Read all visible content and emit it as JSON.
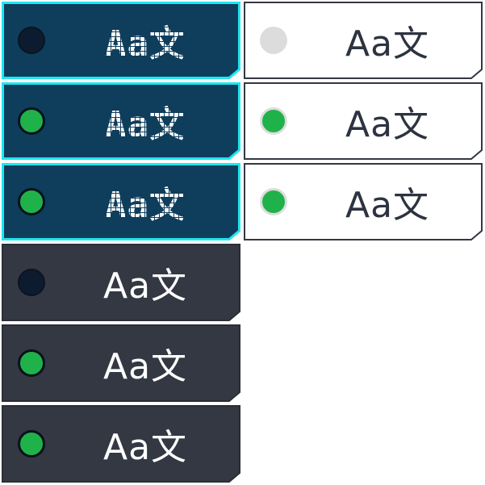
{
  "colors": {
    "retro_fill": "#0f3d5c",
    "retro_border": "#1ee6ee",
    "dark_fill": "#333842",
    "light_fill": "#ffffff",
    "light_border": "#333842",
    "indicator_on": "#1fb24a",
    "indicator_off_dark": "#0d1b2e",
    "indicator_off_light": "#dcdcdc"
  },
  "retro_column": [
    {
      "label": "Aa文",
      "indicator": "off"
    },
    {
      "label": "Aa文",
      "indicator": "on"
    },
    {
      "label": "Aa文",
      "indicator": "on"
    }
  ],
  "light_column": [
    {
      "label": "Aa文",
      "indicator": "off"
    },
    {
      "label": "Aa文",
      "indicator": "on"
    },
    {
      "label": "Aa文",
      "indicator": "on"
    }
  ],
  "dark_column": [
    {
      "label": "Aa文",
      "indicator": "off"
    },
    {
      "label": "Aa文",
      "indicator": "on"
    },
    {
      "label": "Aa文",
      "indicator": "on"
    }
  ]
}
